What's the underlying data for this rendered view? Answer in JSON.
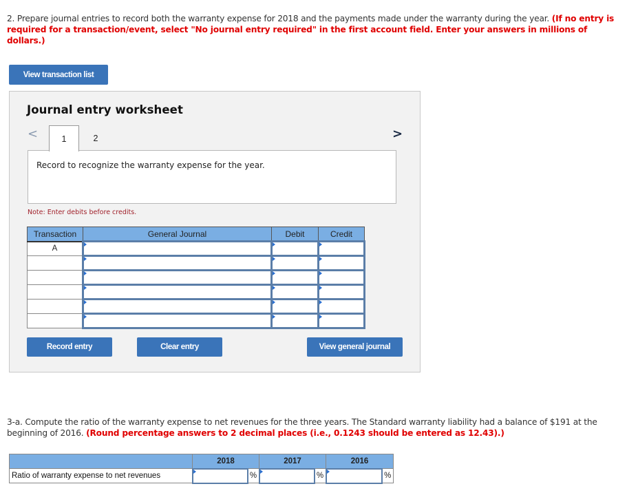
{
  "question2": {
    "text": "2. Prepare journal entries to record both the warranty expense for 2018 and the payments made under the warranty during the year. ",
    "instruction": "(If no entry is required for a transaction/event, select \"No journal entry required\" in the first account field. Enter your answers in millions of dollars.)"
  },
  "buttons": {
    "view_transaction_list": "View transaction list",
    "record_entry": "Record entry",
    "clear_entry": "Clear entry",
    "view_general_journal": "View general journal"
  },
  "worksheet": {
    "title": "Journal entry worksheet",
    "prev_icon": "<",
    "next_icon": ">",
    "tabs": [
      {
        "label": "1",
        "active": true
      },
      {
        "label": "2",
        "active": false
      }
    ],
    "description": "Record to recognize the warranty expense for the year.",
    "note": "Note: Enter debits before credits."
  },
  "journal_table": {
    "headers": [
      "Transaction",
      "General Journal",
      "Debit",
      "Credit"
    ],
    "rows": [
      {
        "transaction": "A",
        "account": "",
        "debit": "",
        "credit": ""
      },
      {
        "transaction": "",
        "account": "",
        "debit": "",
        "credit": ""
      },
      {
        "transaction": "",
        "account": "",
        "debit": "",
        "credit": ""
      },
      {
        "transaction": "",
        "account": "",
        "debit": "",
        "credit": ""
      },
      {
        "transaction": "",
        "account": "",
        "debit": "",
        "credit": ""
      },
      {
        "transaction": "",
        "account": "",
        "debit": "",
        "credit": ""
      }
    ]
  },
  "question3a": {
    "text": "3-a. Compute the ratio of the warranty expense to net revenues for the three years. The Standard warranty liability had a balance of $191 at the beginning of 2016. ",
    "instruction": "(Round percentage answers to 2 decimal places (i.e., 0.1243 should be entered as 12.43).)"
  },
  "ratio_table": {
    "years": [
      "2018",
      "2017",
      "2016"
    ],
    "row_label": "Ratio of warranty expense to net revenues",
    "unit": "%",
    "values": [
      "",
      "",
      ""
    ]
  },
  "colors": {
    "button": "#3a74b9",
    "header": "#7aaee3",
    "input_border": "#5b7ea8",
    "instruction_red": "#e00000"
  }
}
